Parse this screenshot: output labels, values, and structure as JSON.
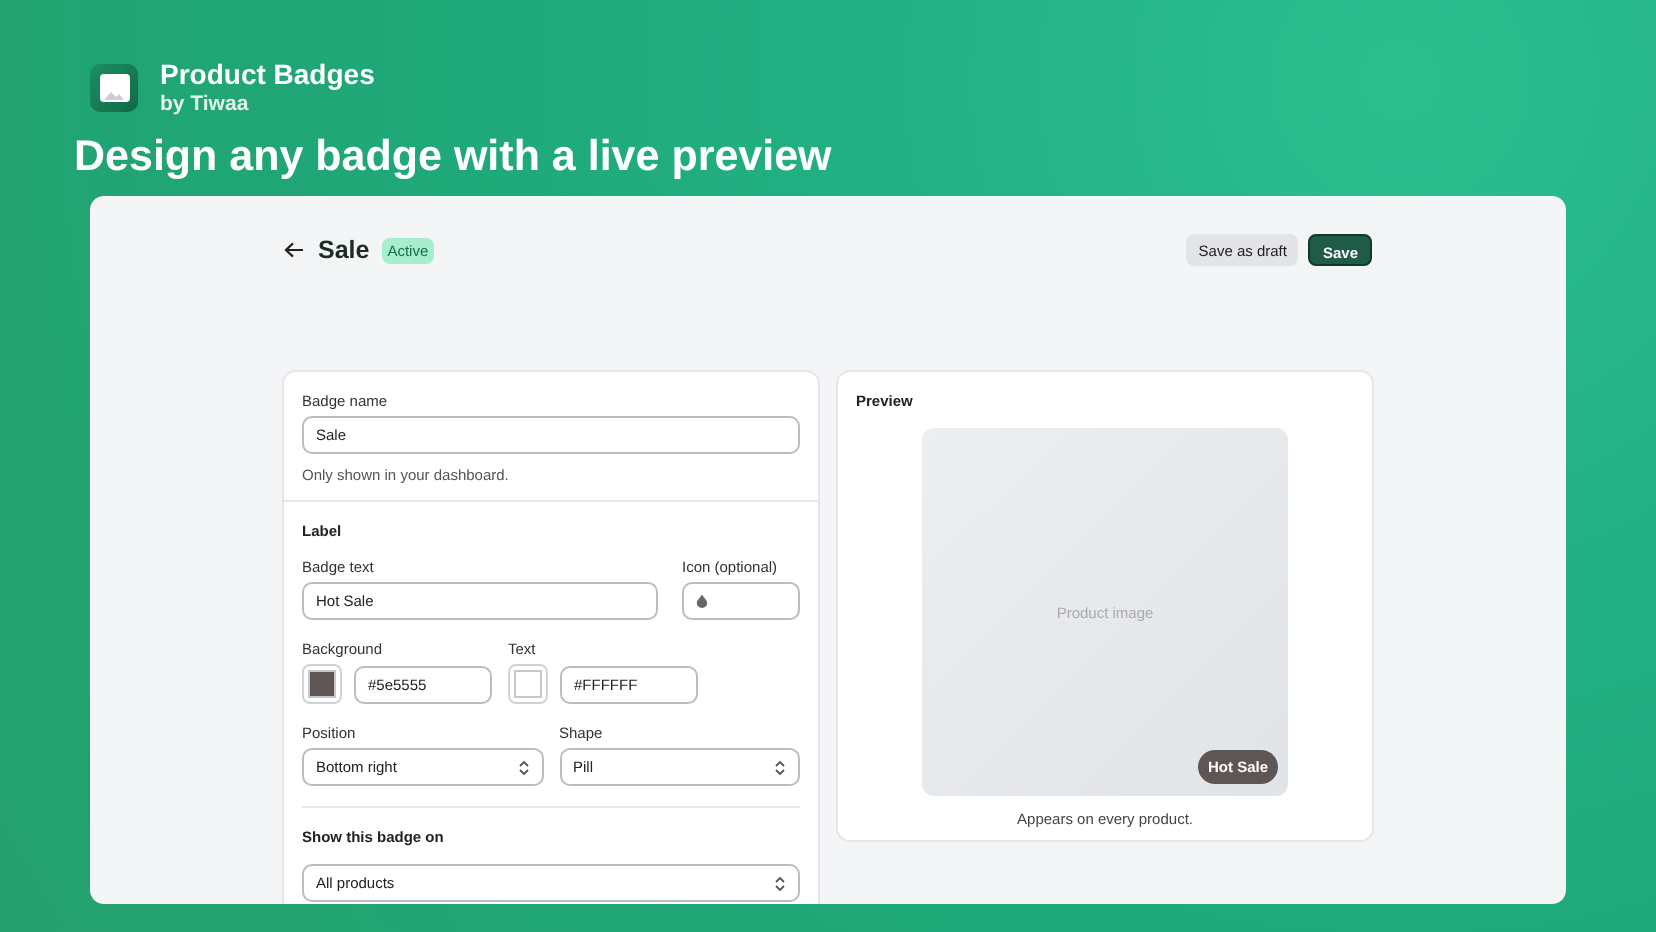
{
  "app": {
    "name": "Product Badges",
    "author": "by Tiwaa"
  },
  "headline": "Design any badge with a live preview",
  "editor": {
    "title": "Sale",
    "status": "Active",
    "buttons": [
      "Save as draft",
      "Save"
    ],
    "form": {
      "badge_name": {
        "label": "Badge name",
        "value": "Sale",
        "help": "Only shown in your dashboard."
      },
      "section_title": "Label",
      "badge_text": {
        "label": "Badge text",
        "value": "Hot Sale"
      },
      "icon": {
        "label": "Icon (optional)"
      },
      "background": {
        "label": "Background",
        "value": "#5e5555"
      },
      "text_color": {
        "label": "Text",
        "value": "#FFFFFF"
      },
      "position": {
        "label": "Position",
        "value": "Bottom right"
      },
      "shape": {
        "label": "Shape",
        "value": "Pill"
      },
      "show_on": {
        "label": "Show this badge on",
        "value": "All products"
      }
    },
    "preview": {
      "title": "Preview",
      "placeholder": "Product image",
      "badge": "Hot Sale",
      "caption": "Appears on every product."
    }
  }
}
